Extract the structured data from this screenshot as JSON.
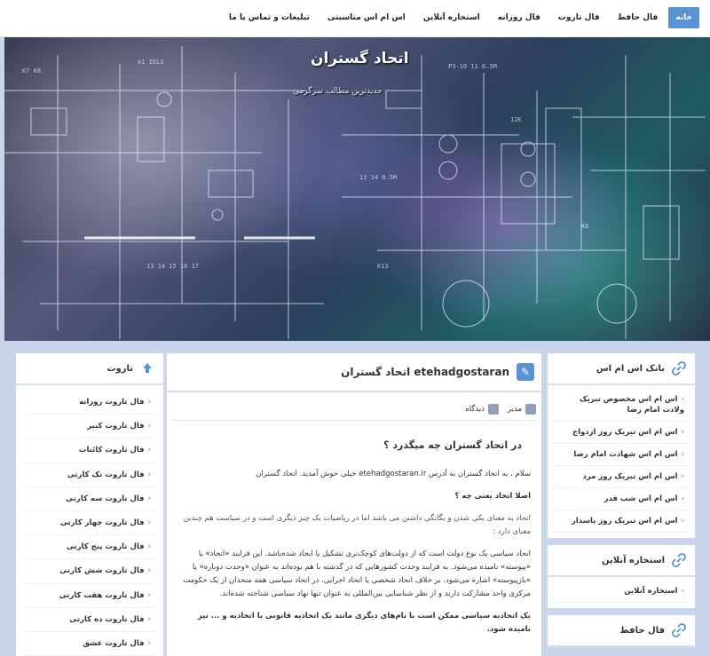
{
  "nav": {
    "items": [
      {
        "label": "خانه",
        "active": true
      },
      {
        "label": "فال حافظ"
      },
      {
        "label": "فال تاروت"
      },
      {
        "label": "فال روزانه"
      },
      {
        "label": "استخاره آنلاین"
      },
      {
        "label": "اس ام اس مناسبتی"
      },
      {
        "label": "تبلیغات و تماس با ما"
      }
    ]
  },
  "banner": {
    "title": "اتحاد گستران",
    "subtitle": "جدیدترین مطالب سرگرمی"
  },
  "left": {
    "header": "تاروت",
    "items": [
      "فال تاروت روزانه",
      "فال تاروت کبیر",
      "فال تاروت کائنات",
      "فال تاروت تک کارتی",
      "فال تاروت سه کارتی",
      "فال تاروت چهار کارتی",
      "فال تاروت پنج کارتی",
      "فال تاروت شش کارتی",
      "فال تاروت هفت کارتی",
      "فال تاروت ده کارتی",
      "فال تاروت عشق"
    ]
  },
  "article": {
    "title": "اتحاد گستران etehadgostaran",
    "author": "مدیر",
    "views": "دیدگاه",
    "heading": "در اتحاد گستران چه میگذرد ؟",
    "p1": "سلام ، به اتحاد گستران به آدرس etehadgostaran.ir خیلی خوش آمدید.",
    "p1_extra": "اتحاد گستران",
    "p2": "اصلا اتحاد یعنی چه ؟",
    "p3": "اتحاد به معنای یکی شدن و یگانگی داشتن می باشد اما در ریاضیات یک چیز دیگری است و در سیاست هم چندین معنای دارد :",
    "p4": "اتحاد سیاسی یک نوع دولت است که از دولت‌های کوچک‌تری تشکیل یا ایجاد شده‌باشد. این فرایند «اتحاد» یا «پیوسته» نامیده می‌شود. به فرایند وحدت کشورهایی که در گذشته با هم بوده‌اند به عنوان «وحدت دوباره» یا «بازپیوسته» اشاره می‌شود. بر خلاف اتحاد شخصی یا اتحاد اجرایی، در اتحاد سیاسی همه متحدان از یک حکومت مرکزی واحد مشارکت دارند و از نظر شناسایی بین‌المللی به عنوان تنها نهاد سیاسی شناخته شده‌اند.",
    "p5": "یک اتحادیه سیاسی ممکن است با نام‌های دیگری مانند یک اتحادیه قانونی یا اتحادیه و ... نیز نامیده شود."
  },
  "right": {
    "boxes": [
      {
        "header": "بانک اس ام اس",
        "items": [
          "اس ام اس مخصوص تبریک ولادت امام رضا",
          "اس ام اس تبریک روز ازدواج",
          "اس ام اس شهادت امام رضا",
          "اس ام اس تبریک روز مرد",
          "اس ام اس شب قدر",
          "اس ام اس تبریک روز پاسدار"
        ]
      },
      {
        "header": "استخاره آنلاین",
        "items": [
          "استخاره آنلاین"
        ]
      },
      {
        "header": "فال حافظ",
        "items": []
      }
    ]
  },
  "colors": {
    "accent": "#5b92d4",
    "page_bg": "#c9d5ea"
  }
}
